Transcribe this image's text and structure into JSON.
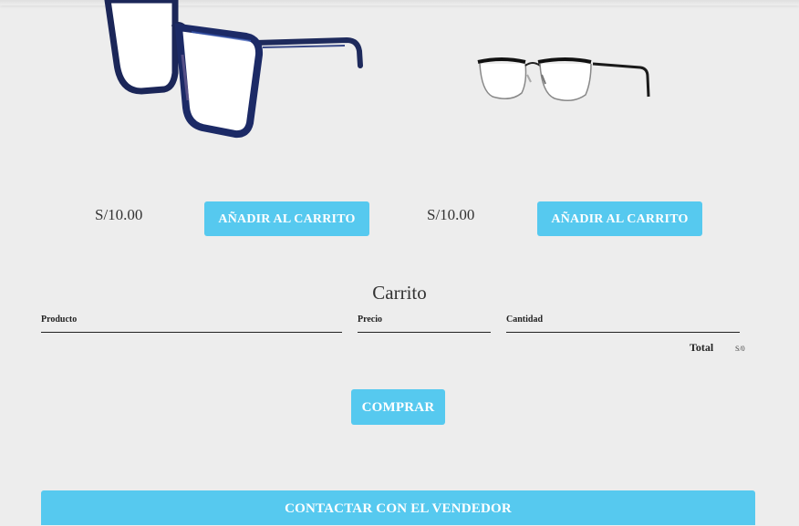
{
  "colors": {
    "accent": "#56c9ef",
    "background": "#ededed",
    "button_text": "#ffffff"
  },
  "products": [
    {
      "image": "blue-frame-glasses",
      "price": "S/10.00",
      "add_label": "AÑADIR AL CARRITO"
    },
    {
      "image": "black-half-rim-glasses",
      "price": "S/10.00",
      "add_label": "AÑADIR AL CARRITO"
    }
  ],
  "cart": {
    "title": "Carrito",
    "columns": [
      "Producto",
      "Precio",
      "Cantidad"
    ],
    "total_label": "Total",
    "total_value": "S/0",
    "buy_label": "COMPRAR"
  },
  "contact": {
    "label": "CONTACTAR CON EL VENDEDOR"
  }
}
